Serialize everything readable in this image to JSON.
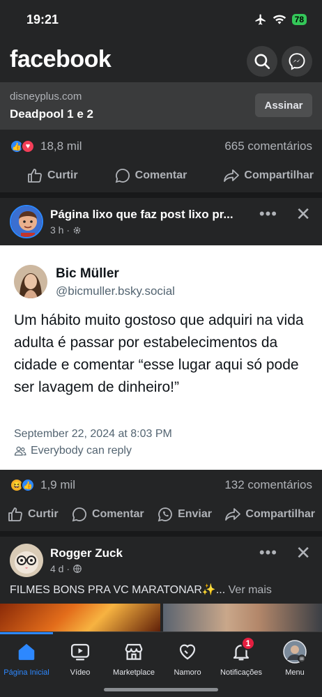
{
  "status_bar": {
    "time": "19:21",
    "battery": "78"
  },
  "header": {
    "logo": "facebook"
  },
  "ad": {
    "domain": "disneyplus.com",
    "title": "Deadpool 1 e 2",
    "button": "Assinar"
  },
  "post1": {
    "reaction_count": "18,8 mil",
    "comments": "665 comentários",
    "actions": {
      "like": "Curtir",
      "comment": "Comentar",
      "share": "Compartilhar"
    }
  },
  "post2": {
    "page_name": "Página lixo que faz post lixo pr...",
    "time": "3 h ·",
    "tweet": {
      "name": "Bic Müller",
      "handle": "@bicmuller.bsky.social",
      "text": "Um hábito muito gostoso que adquiri na vida adulta é passar por estabelecimentos da cidade e comentar “esse lugar aqui só pode ser lavagem de dinheiro!”",
      "date": "September 22, 2024 at 8:03 PM",
      "reply_setting": "Everybody can reply"
    },
    "reaction_count": "1,9 mil",
    "comments": "132 comentários",
    "actions": {
      "like": "Curtir",
      "comment": "Comentar",
      "send": "Enviar",
      "share": "Compartilhar"
    }
  },
  "post3": {
    "name": "Rogger Zuck",
    "time": "4 d ·",
    "caption": "FILMES BONS PRA VC MARATONAR✨...",
    "see_more": "Ver mais"
  },
  "tabs": [
    {
      "label": "Página Inicial"
    },
    {
      "label": "Vídeo"
    },
    {
      "label": "Marketplace"
    },
    {
      "label": "Namoro"
    },
    {
      "label": "Notificações",
      "badge": "1"
    },
    {
      "label": "Menu"
    }
  ],
  "colors": {
    "accent": "#2d88ff",
    "background": "#242526",
    "badge": "#e41e3f"
  }
}
